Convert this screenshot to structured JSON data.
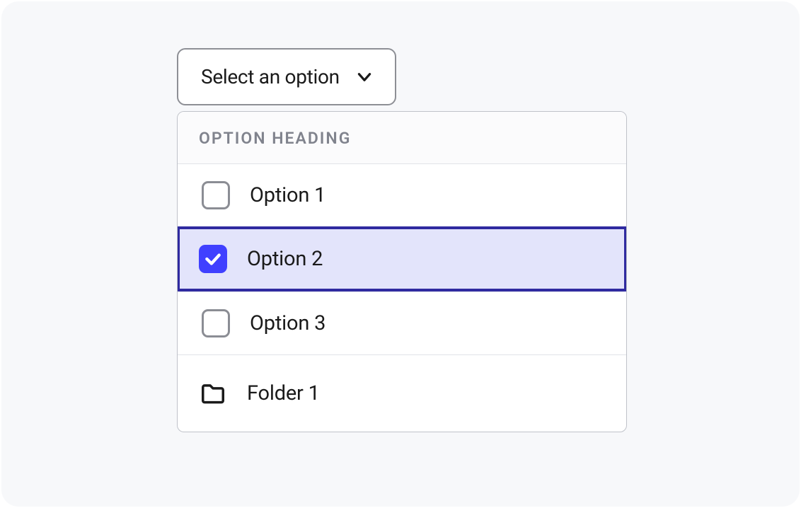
{
  "select": {
    "trigger_label": "Select an option",
    "heading": "OPTION HEADING",
    "options": [
      {
        "label": "Option 1",
        "checked": false
      },
      {
        "label": "Option 2",
        "checked": true
      },
      {
        "label": "Option 3",
        "checked": false
      }
    ],
    "folder": {
      "label": "Folder 1"
    }
  },
  "colors": {
    "accent": "#4040ff",
    "focus_ring": "#2f2aa0",
    "selected_bg": "#e3e4fb"
  }
}
